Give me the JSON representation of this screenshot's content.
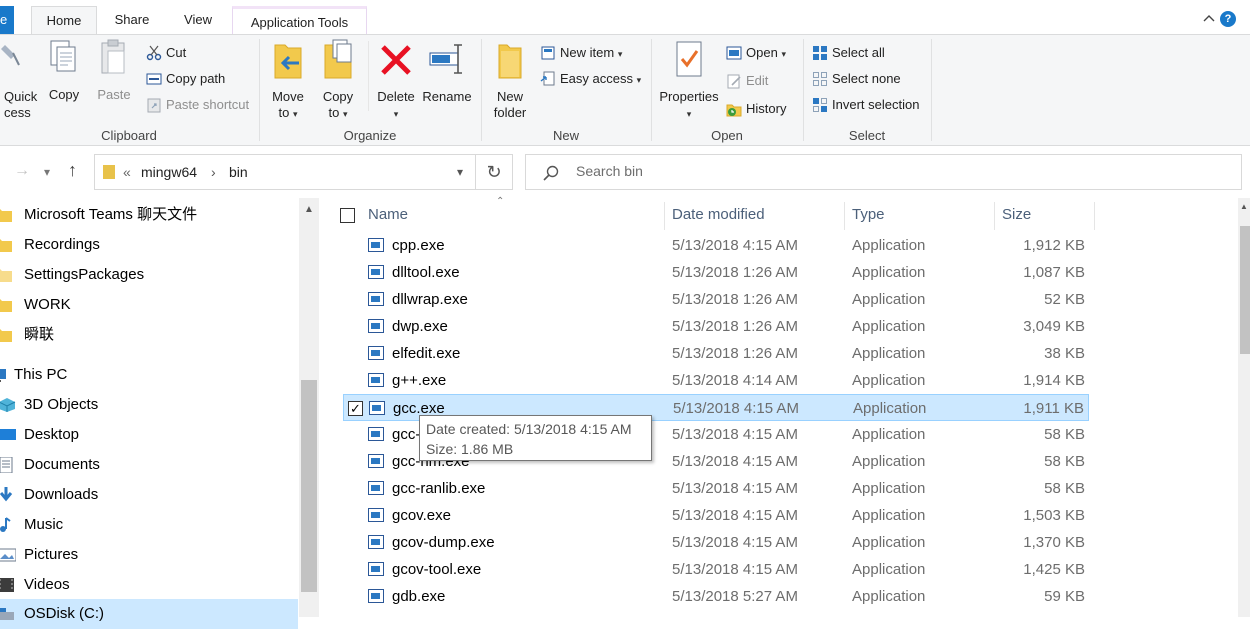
{
  "tabs": {
    "file_partial": "e",
    "home": "Home",
    "share": "Share",
    "view": "View",
    "app_tools": "Application Tools"
  },
  "ribbon": {
    "clipboard": {
      "label": "Clipboard",
      "quick_access_line1": "Quick",
      "quick_access_line2": "cess",
      "copy": "Copy",
      "paste": "Paste",
      "cut": "Cut",
      "copy_path": "Copy path",
      "paste_shortcut": "Paste shortcut"
    },
    "organize": {
      "label": "Organize",
      "move_to_line1": "Move",
      "move_to_line2": "to",
      "copy_to_line1": "Copy",
      "copy_to_line2": "to",
      "delete": "Delete",
      "rename": "Rename"
    },
    "new": {
      "label": "New",
      "new_folder_line1": "New",
      "new_folder_line2": "folder",
      "new_item": "New item",
      "easy_access": "Easy access"
    },
    "open": {
      "label": "Open",
      "properties": "Properties",
      "open": "Open",
      "edit": "Edit",
      "history": "History"
    },
    "select": {
      "label": "Select",
      "select_all": "Select all",
      "select_none": "Select none",
      "invert_selection": "Invert selection"
    }
  },
  "address": {
    "overflow": "«",
    "crumb1": "mingw64",
    "sep": "›",
    "crumb2": "bin"
  },
  "search": {
    "placeholder": "Search bin"
  },
  "nav_pane": [
    {
      "label": "Microsoft Teams 聊天文件",
      "icon": "folder-icon"
    },
    {
      "label": "Recordings",
      "icon": "folder-icon"
    },
    {
      "label": "SettingsPackages",
      "icon": "folder-icon"
    },
    {
      "label": "WORK",
      "icon": "folder-icon"
    },
    {
      "label": "瞬联",
      "icon": "folder-icon"
    },
    {
      "label": "This PC",
      "icon": "pc-icon"
    },
    {
      "label": "3D Objects",
      "icon": "3d-objects-icon"
    },
    {
      "label": "Desktop",
      "icon": "desktop-icon"
    },
    {
      "label": "Documents",
      "icon": "documents-icon"
    },
    {
      "label": "Downloads",
      "icon": "downloads-icon"
    },
    {
      "label": "Music",
      "icon": "music-icon"
    },
    {
      "label": "Pictures",
      "icon": "pictures-icon"
    },
    {
      "label": "Videos",
      "icon": "videos-icon"
    },
    {
      "label": "OSDisk (C:)",
      "icon": "drive-icon"
    }
  ],
  "columns": {
    "name": "Name",
    "date_modified": "Date modified",
    "type": "Type",
    "size": "Size"
  },
  "files": [
    {
      "name": "cpp.exe",
      "date": "5/13/2018 4:15 AM",
      "type": "Application",
      "size": "1,912 KB"
    },
    {
      "name": "dlltool.exe",
      "date": "5/13/2018 1:26 AM",
      "type": "Application",
      "size": "1,087 KB"
    },
    {
      "name": "dllwrap.exe",
      "date": "5/13/2018 1:26 AM",
      "type": "Application",
      "size": "52 KB"
    },
    {
      "name": "dwp.exe",
      "date": "5/13/2018 1:26 AM",
      "type": "Application",
      "size": "3,049 KB"
    },
    {
      "name": "elfedit.exe",
      "date": "5/13/2018 1:26 AM",
      "type": "Application",
      "size": "38 KB"
    },
    {
      "name": "g++.exe",
      "date": "5/13/2018 4:14 AM",
      "type": "Application",
      "size": "1,914 KB"
    },
    {
      "name": "gcc.exe",
      "date": "5/13/2018 4:15 AM",
      "type": "Application",
      "size": "1,911 KB"
    },
    {
      "name": "gcc-",
      "date": "5/13/2018 4:15 AM",
      "type": "Application",
      "size": "58 KB"
    },
    {
      "name": "gcc-nm.exe",
      "date": "5/13/2018 4:15 AM",
      "type": "Application",
      "size": "58 KB"
    },
    {
      "name": "gcc-ranlib.exe",
      "date": "5/13/2018 4:15 AM",
      "type": "Application",
      "size": "58 KB"
    },
    {
      "name": "gcov.exe",
      "date": "5/13/2018 4:15 AM",
      "type": "Application",
      "size": "1,503 KB"
    },
    {
      "name": "gcov-dump.exe",
      "date": "5/13/2018 4:15 AM",
      "type": "Application",
      "size": "1,370 KB"
    },
    {
      "name": "gcov-tool.exe",
      "date": "5/13/2018 4:15 AM",
      "type": "Application",
      "size": "1,425 KB"
    },
    {
      "name": "gdb.exe",
      "date": "5/13/2018 5:27 AM",
      "type": "Application",
      "size": "59 KB"
    }
  ],
  "tooltip": {
    "line1": "Date created: 5/13/2018 4:15 AM",
    "line2": "Size: 1.86 MB"
  },
  "colors": {
    "accent": "#1979ca",
    "selection": "#cce8ff",
    "selection_border": "#99d1ff",
    "delete_red": "#e81123",
    "folder": "#e8c24a"
  }
}
